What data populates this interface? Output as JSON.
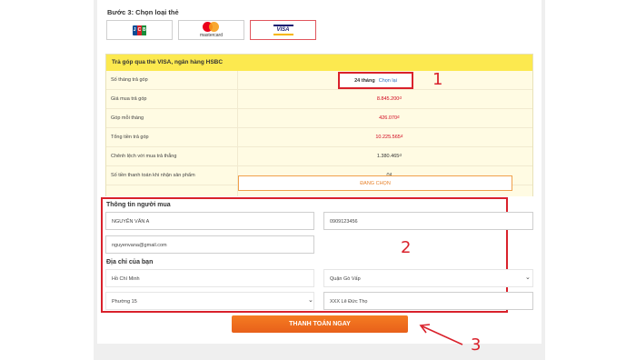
{
  "step": {
    "title": "Bước 3: Chọn loại thẻ"
  },
  "cards": [
    {
      "name": "JCB",
      "selected": false,
      "logo_letters": [
        "J",
        "C",
        "B"
      ],
      "logo_colors": [
        "#0e4c96",
        "#d8232a",
        "#1a8d3a"
      ]
    },
    {
      "name": "mastercard",
      "selected": false,
      "label": "mastercard"
    },
    {
      "name": "VISA",
      "selected": true,
      "label": "VISA"
    }
  ],
  "plan": {
    "header": "Trả góp qua thẻ VISA, ngân hàng HSBC",
    "rows": [
      {
        "label": "Số tháng trả góp",
        "value": "24 tháng",
        "action": "Chọn lại"
      },
      {
        "label": "Giá mua trả góp",
        "value": "8.845.200₫"
      },
      {
        "label": "Góp mỗi tháng",
        "value": "426.070₫"
      },
      {
        "label": "Tổng tiền trả góp",
        "value": "10.225.565₫"
      },
      {
        "label": "Chênh lệch với mua trả thẳng",
        "value": "1.380.465₫"
      },
      {
        "label": "Số tiền thanh toán khi nhận sản phẩm",
        "value": "0₫"
      }
    ],
    "choosing_label": "ĐANG CHỌN"
  },
  "buyer": {
    "title": "Thông tin người mua",
    "name": "NGUYỄN VĂN A",
    "phone": "0909123456",
    "email": "nguyenvana@gmail.com"
  },
  "address": {
    "title": "Địa chỉ của bạn",
    "city": "Hồ Chí Minh",
    "district": "Quận Gò Vấp",
    "ward": "Phường 15",
    "street": "XXX Lê Đức Thọ"
  },
  "pay_button": "THANH TOÁN NGAY",
  "annotations": {
    "one": "1",
    "two": "2",
    "three": "3"
  },
  "colors": {
    "accent_red": "#d9212b",
    "pay_orange": "#f57c22",
    "header_yellow": "#fce94f",
    "link_blue": "#2a6ebd"
  }
}
